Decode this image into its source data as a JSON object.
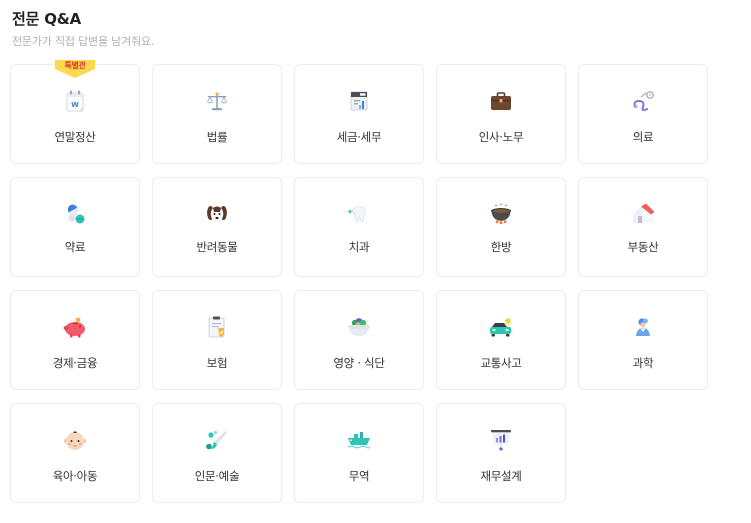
{
  "header": {
    "title": "전문 Q&A",
    "subtitle": "전문가가 직접 답변을 남겨줘요."
  },
  "categories": [
    {
      "label": "연말정산",
      "icon": "calendar-icon",
      "badge": "특별관"
    },
    {
      "label": "법률",
      "icon": "scales-icon"
    },
    {
      "label": "세금·세무",
      "icon": "tax-report-icon"
    },
    {
      "label": "인사·노무",
      "icon": "briefcase-icon"
    },
    {
      "label": "의료",
      "icon": "stethoscope-icon"
    },
    {
      "label": "약료",
      "icon": "pills-icon"
    },
    {
      "label": "반려동물",
      "icon": "dog-icon"
    },
    {
      "label": "치과",
      "icon": "tooth-icon"
    },
    {
      "label": "한방",
      "icon": "herbal-pot-icon"
    },
    {
      "label": "부동산",
      "icon": "house-icon"
    },
    {
      "label": "경제·금융",
      "icon": "piggy-bank-icon"
    },
    {
      "label": "보험",
      "icon": "insurance-clipboard-icon"
    },
    {
      "label": "영양 · 식단",
      "icon": "salad-bowl-icon"
    },
    {
      "label": "교통사고",
      "icon": "car-crash-icon"
    },
    {
      "label": "과학",
      "icon": "scientist-icon"
    },
    {
      "label": "육아·아동",
      "icon": "baby-icon"
    },
    {
      "label": "인문·예술",
      "icon": "brush-icon"
    },
    {
      "label": "무역",
      "icon": "cargo-ship-icon"
    },
    {
      "label": "재무설계",
      "icon": "financial-chart-icon"
    }
  ],
  "colors": {
    "card_border": "#ececec",
    "title": "#222222",
    "subtitle": "#b0b0b0",
    "badge_fill": "#ffd84d",
    "badge_text": "#d63b2a"
  }
}
